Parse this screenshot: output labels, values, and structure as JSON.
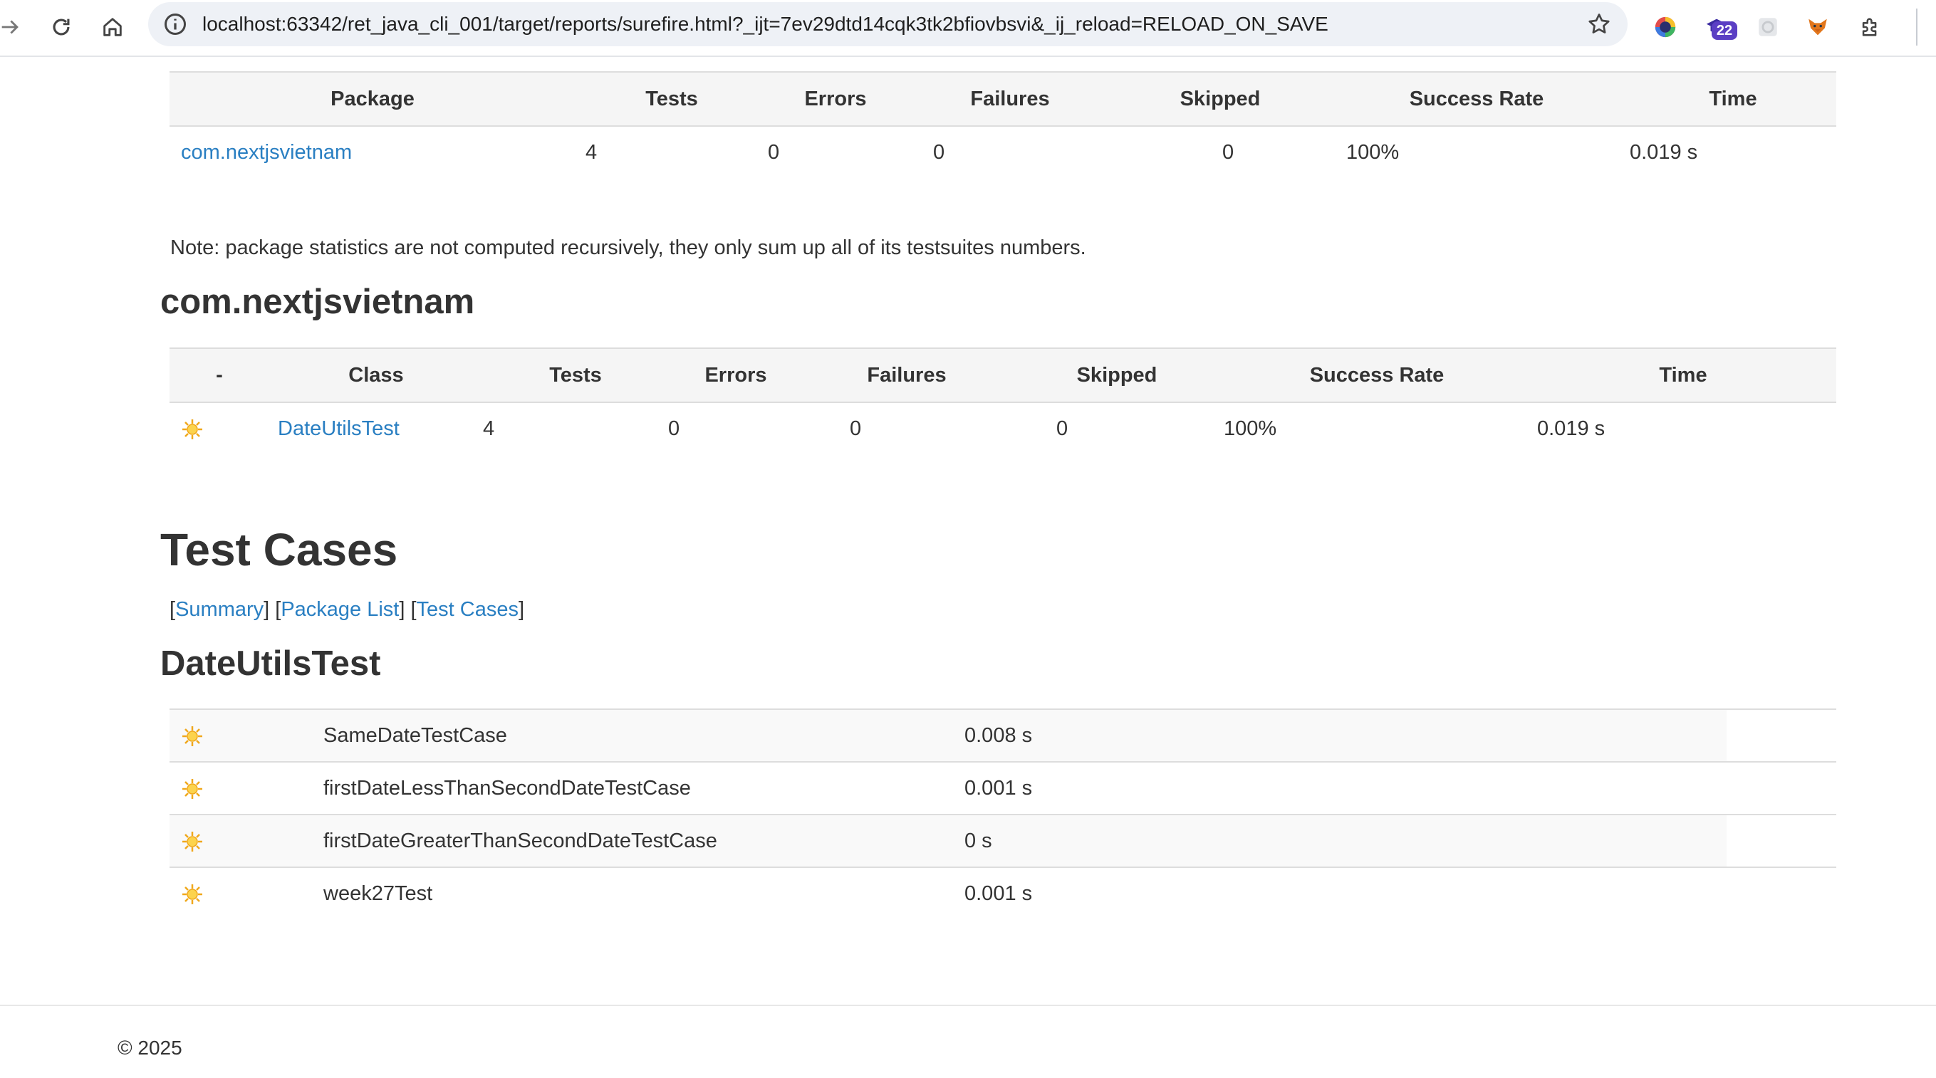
{
  "browser": {
    "url": "localhost:63342/ret_java_cli_001/target/reports/surefire.html?_ijt=7ev29dtd14cqk3tk2bfiovbsvi&_ij_reload=RELOAD_ON_SAVE",
    "extension_badge": "22"
  },
  "package_table": {
    "headers": [
      "Package",
      "Tests",
      "Errors",
      "Failures",
      "Skipped",
      "Success Rate",
      "Time"
    ],
    "rows": [
      {
        "package": "com.nextjsvietnam",
        "tests": "4",
        "errors": "0",
        "failures": "0",
        "skipped": "0",
        "success_rate": "100%",
        "time": "0.019 s"
      }
    ]
  },
  "note": "Note: package statistics are not computed recursively, they only sum up all of its testsuites numbers.",
  "package_section": {
    "title": "com.nextjsvietnam",
    "headers": [
      "-",
      "Class",
      "Tests",
      "Errors",
      "Failures",
      "Skipped",
      "Success Rate",
      "Time"
    ],
    "rows": [
      {
        "class": "DateUtilsTest",
        "tests": "4",
        "errors": "0",
        "failures": "0",
        "skipped": "0",
        "success_rate": "100%",
        "time": "0.019 s"
      }
    ]
  },
  "test_cases_section": {
    "title": "Test Cases",
    "links": [
      "Summary",
      "Package List",
      "Test Cases"
    ],
    "class_title": "DateUtilsTest",
    "cases": [
      {
        "name": "SameDateTestCase",
        "time": "0.008 s"
      },
      {
        "name": "firstDateLessThanSecondDateTestCase",
        "time": "0.001 s"
      },
      {
        "name": "firstDateGreaterThanSecondDateTestCase",
        "time": "0 s"
      },
      {
        "name": "week27Test",
        "time": "0.001 s"
      }
    ]
  },
  "footer": "© 2025",
  "icons": {
    "success": "success-sun-icon",
    "accent": "#2a7fc2"
  }
}
